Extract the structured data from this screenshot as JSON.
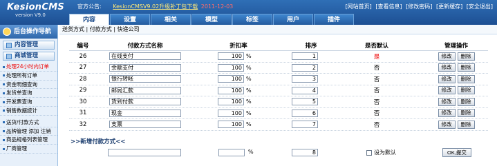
{
  "app": {
    "logo_title": "KesionCMS",
    "logo_version": "version V9.0",
    "notice_label": "官方公告:",
    "notice_link": "KesionCMSV9.02升级补丁包下载",
    "notice_date": "2011-12-03",
    "top_links": [
      "[网站首页]",
      "[查看信息]",
      "[修改密码]",
      "[更新缓存]",
      "[安全退出]"
    ],
    "nav_tabs": [
      "内容",
      "设置",
      "相关",
      "模型",
      "标签",
      "用户",
      "插件"
    ],
    "active_tab": 0
  },
  "sidebar": {
    "header": "后台操作导航",
    "groups": [
      "内容管理",
      "商城管理"
    ],
    "items_top": [
      "处理24小时内订单",
      "处理所有订单",
      "资金明细查询",
      "发货单查询",
      "开发票查询",
      "销售数据统计"
    ],
    "items_bottom": [
      "送货/付款方式",
      "品牌管理 添加 注销",
      "商品规格列表管理",
      "厂商管理"
    ]
  },
  "breadcrumb": "送货方式 | 付款方式 | 快递公司",
  "table": {
    "headers": [
      "编号",
      "付款方式名称",
      "折扣率",
      "排序",
      "是否默认",
      "管理操作"
    ],
    "rows": [
      {
        "id": "26",
        "name": "在线支付",
        "rate": "100",
        "order": "1",
        "default": "是"
      },
      {
        "id": "27",
        "name": "余额支付",
        "rate": "100",
        "order": "2",
        "default": "否"
      },
      {
        "id": "28",
        "name": "银行转帐",
        "rate": "100",
        "order": "3",
        "default": "否"
      },
      {
        "id": "29",
        "name": "邮局汇款",
        "rate": "100",
        "order": "4",
        "default": "否"
      },
      {
        "id": "30",
        "name": "货到付款",
        "rate": "100",
        "order": "5",
        "default": "否"
      },
      {
        "id": "31",
        "name": "现金",
        "rate": "100",
        "order": "6",
        "default": "否"
      },
      {
        "id": "32",
        "name": "支票",
        "rate": "100",
        "order": "7",
        "default": "否"
      }
    ],
    "percent_sign": "%",
    "edit_label": "修改",
    "delete_label": "删除"
  },
  "new_section": {
    "title": ">>新增付款方式<<",
    "name_value": "",
    "rate_value": "",
    "percent_sign": "%",
    "order_value": "8",
    "default_label": "设为默认",
    "submit_label": "OK,提交"
  }
}
